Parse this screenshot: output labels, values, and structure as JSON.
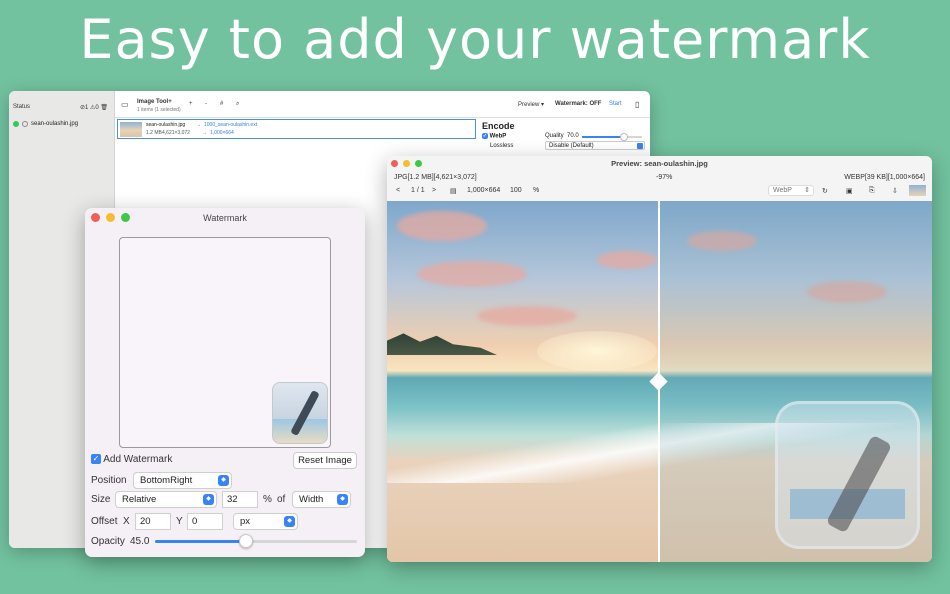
{
  "hero": {
    "title": "Easy to add your watermark"
  },
  "main_window": {
    "sidebar": {
      "status_label": "Status",
      "done_count": "1",
      "warn_count": "0",
      "file_name": "sean-oulashin.jpg"
    },
    "toolbar": {
      "app_title": "Image Tool+",
      "subtitle": "1 items (1 selected)",
      "add": "+",
      "remove": "-",
      "hash": "#",
      "preview_label": "Preview",
      "watermark_status": "Watermark: OFF",
      "start_label": "Start"
    },
    "file_row": {
      "source_name": "sean-oulashin.jpg",
      "dest_name": "1000_sean-oulashin.ext",
      "source_size": "1.2 MB",
      "source_dims": "4,621×3,072",
      "dest_dims": "1,000×664"
    },
    "encode": {
      "title": "Encode",
      "format": "WebP",
      "quality_label": "Quality",
      "quality_value": "70.0",
      "quality_fraction": 0.7,
      "lossless_label": "Lossless",
      "lossless_value": "Disable (Default)"
    }
  },
  "watermark_window": {
    "title": "Watermark",
    "add_watermark_label": "Add Watermark",
    "add_watermark_checked": true,
    "reset_label": "Reset Image",
    "position_label": "Position",
    "position_value": "BottomRight",
    "size_label": "Size",
    "size_mode": "Relative",
    "size_value": "32",
    "percent": "%",
    "of_label": "of",
    "size_ref": "Width",
    "offset_label": "Offset",
    "x_label": "X",
    "x_value": "20",
    "y_label": "Y",
    "y_value": "0",
    "unit": "px",
    "opacity_label": "Opacity",
    "opacity_value": "45.0",
    "opacity_fraction": 0.45
  },
  "preview_window": {
    "title": "Preview: sean-oulashin.jpg",
    "left_info": "JPG[1.2 MB][4,621×3,072]",
    "delta": "-97%",
    "right_info": "WEBP[39 KB][1,000×664]",
    "prev": "<",
    "page": "1 / 1",
    "next": ">",
    "dims": "1,000×664",
    "zoom": "100",
    "zoom_unit": "%",
    "format": "WebP"
  },
  "colors": {
    "background": "#72c29f",
    "accent": "#3a83f7",
    "start": "#2f7df6"
  }
}
